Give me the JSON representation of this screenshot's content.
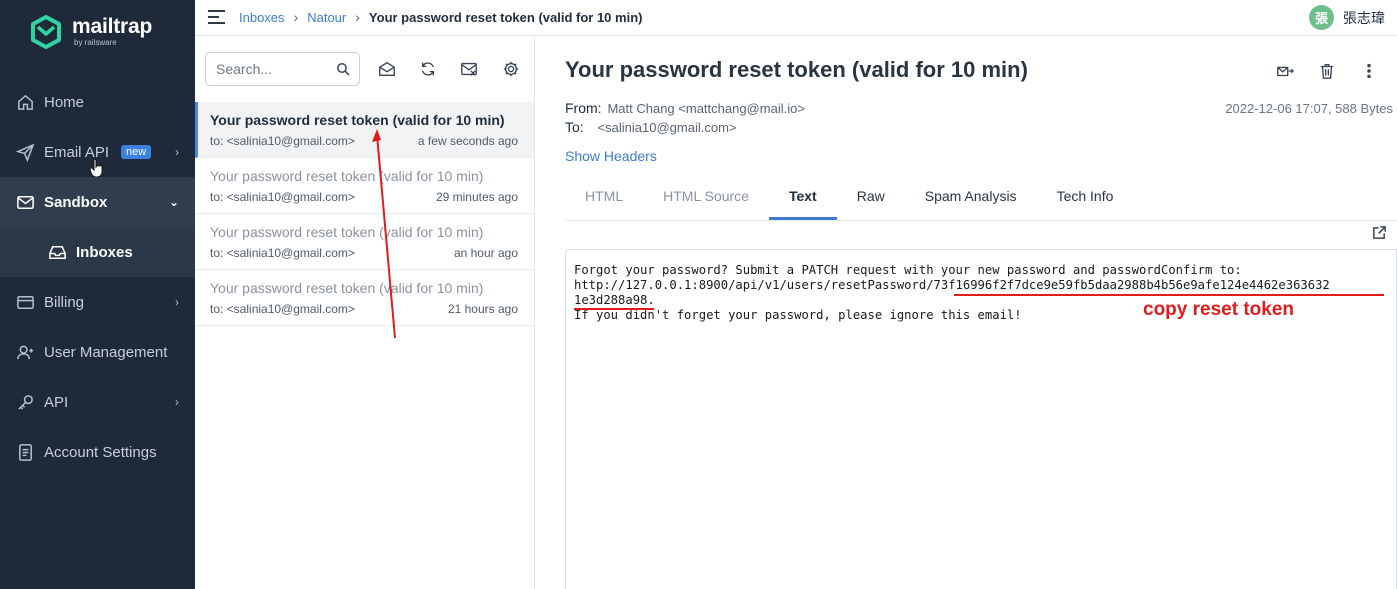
{
  "sidebar": {
    "logo": {
      "name": "mailtrap",
      "sub": "by railsware"
    },
    "items": [
      {
        "label": "Home",
        "icon": "home-icon"
      },
      {
        "label": "Email API",
        "icon": "send-icon",
        "badge": "new"
      },
      {
        "label": "Sandbox",
        "icon": "sandbox-mail-icon"
      },
      {
        "label": "Inboxes",
        "icon": "inbox-icon"
      },
      {
        "label": "Billing",
        "icon": "billing-card-icon"
      },
      {
        "label": "User Management",
        "icon": "user-icon"
      },
      {
        "label": "API",
        "icon": "key-icon"
      },
      {
        "label": "Account Settings",
        "icon": "document-icon"
      }
    ]
  },
  "topbar": {
    "breadcrumbs": [
      "Inboxes",
      "Natour",
      "Your password reset token (valid for 10 min)"
    ],
    "user": {
      "avatar": "張",
      "name": "張志瑋"
    }
  },
  "list": {
    "search_placeholder": "Search...",
    "messages": [
      {
        "subject": "Your password reset token (valid for 10 min)",
        "to": "to: <salinia10@gmail.com>",
        "time": "a few seconds ago"
      },
      {
        "subject": "Your password reset token (valid for 10 min)",
        "to": "to: <salinia10@gmail.com>",
        "time": "29 minutes ago"
      },
      {
        "subject": "Your password reset token (valid for 10 min)",
        "to": "to: <salinia10@gmail.com>",
        "time": "an hour ago"
      },
      {
        "subject": "Your password reset token (valid for 10 min)",
        "to": "to: <salinia10@gmail.com>",
        "time": "21 hours ago"
      }
    ]
  },
  "view": {
    "title": "Your password reset token (valid for 10 min)",
    "from_label": "From:",
    "from": "Matt Chang <mattchang@mail.io>",
    "to_label": "To:",
    "to": "<salinia10@gmail.com>",
    "meta": "2022-12-06 17:07, 588 Bytes",
    "show_headers": "Show Headers",
    "tabs": [
      "HTML",
      "HTML Source",
      "Text",
      "Raw",
      "Spam Analysis",
      "Tech Info"
    ],
    "body_lines": [
      "Forgot your password? Submit a PATCH request with your new password and passwordConfirm to:",
      "http://127.0.0.1:8900/api/v1/users/resetPassword/73f16996f2f7dce9e59fb5daa2988b4b56e9afe124e4462e363632",
      "1e3d288a98.",
      "If you didn't forget your password, please ignore this email!"
    ],
    "annotation": "copy reset token"
  }
}
